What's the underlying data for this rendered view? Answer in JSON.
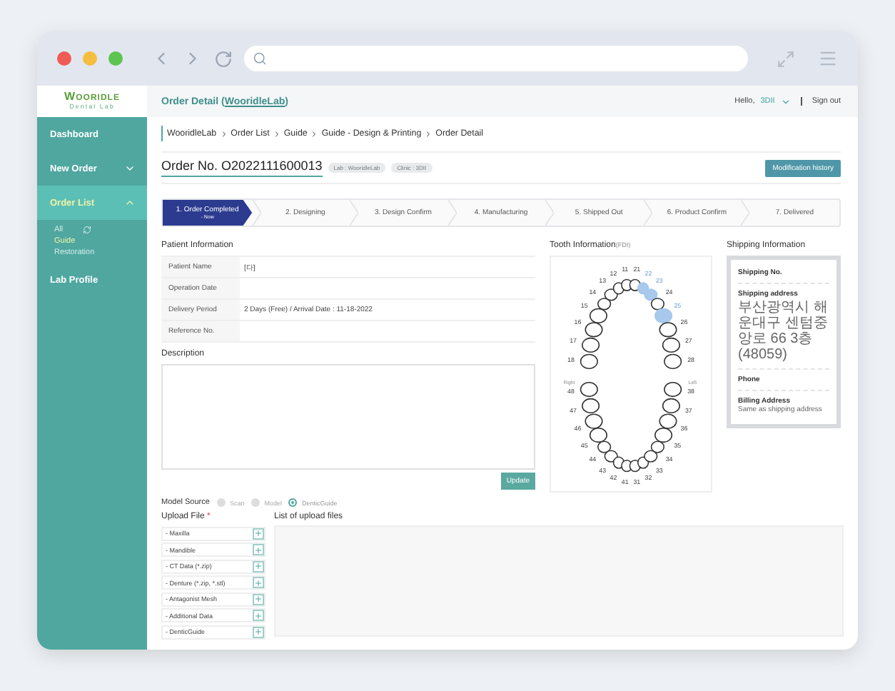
{
  "logo": {
    "name": "WOORIDLE",
    "subtitle": "Dental Lab"
  },
  "sidebar": {
    "items": [
      {
        "label": "Dashboard",
        "kind": "link",
        "expanded": false
      },
      {
        "label": "New Order",
        "kind": "group",
        "expanded": false
      },
      {
        "label": "Order List",
        "kind": "group",
        "expanded": true,
        "children": [
          {
            "label": "All",
            "selected": false,
            "refresh": true
          },
          {
            "label": "Guide",
            "selected": true,
            "refresh": false
          },
          {
            "label": "Restoration",
            "selected": false,
            "refresh": false
          }
        ]
      },
      {
        "label": "Lab Profile",
        "kind": "link",
        "expanded": false
      }
    ]
  },
  "header": {
    "title_before": "Order Detail (",
    "title_link": "WooridleLab",
    "title_after": ")",
    "greeting": "Hello,",
    "user": "3DII",
    "sign_out": "Sign out"
  },
  "breadcrumb": [
    "WooridleLab",
    "Order List",
    "Guide",
    "Guide - Design & Printing",
    "Order Detail"
  ],
  "order": {
    "number": "Order No. O2022111600013",
    "badges": [
      "Lab : WooridleLab",
      "Clinic : 3DII"
    ],
    "history_button": "Modification history"
  },
  "steps": [
    {
      "label": "1. Order Completed",
      "note": "- Now",
      "selected": true
    },
    {
      "label": "2. Designing",
      "selected": false
    },
    {
      "label": "3. Design Confirm",
      "selected": false
    },
    {
      "label": "4. Manufacturing",
      "selected": false
    },
    {
      "label": "5. Shipped Out",
      "selected": false
    },
    {
      "label": "6. Product Confirm",
      "selected": false
    },
    {
      "label": "7. Delivered",
      "selected": false
    }
  ],
  "patient": {
    "title": "Patient Information",
    "rows": [
      {
        "label": "Patient Name",
        "value": "[다]"
      },
      {
        "label": "Operation Date"
      },
      {
        "label": "Delivery Period",
        "value": "2 Days (Free) / Arrival Date : 11-18-2022"
      },
      {
        "label": "Reference No."
      }
    ]
  },
  "description": {
    "title": "Description",
    "button": "Update"
  },
  "model_source": {
    "label": "Model Source",
    "options": [
      {
        "label": "Scan",
        "selected": false
      },
      {
        "label": "Model",
        "selected": false
      },
      {
        "label": "DenticGuide",
        "selected": true
      }
    ]
  },
  "upload": {
    "title": "Upload File",
    "required_mark": "*",
    "items": [
      "- Maxilla",
      "- Mandible",
      "- CT Data (*.zip)",
      "- Denture (*.zip, *.stl)",
      "- Antagonist Mesh",
      "- Additional Data",
      "- DenticGuide"
    ],
    "list_title": "List of upload files"
  },
  "tooth": {
    "title": "Tooth Information",
    "system": "(FDI)",
    "right_label": "Right",
    "left_label": "Left",
    "upper": [
      {
        "label": "18",
        "selected": false
      },
      {
        "label": "17",
        "selected": false
      },
      {
        "label": "16",
        "selected": false
      },
      {
        "label": "15",
        "selected": false
      },
      {
        "label": "14",
        "selected": false
      },
      {
        "label": "13",
        "selected": false
      },
      {
        "label": "12",
        "selected": false
      },
      {
        "label": "11",
        "selected": false
      },
      {
        "label": "21",
        "selected": false
      },
      {
        "label": "22",
        "selected": true
      },
      {
        "label": "23",
        "selected": true
      },
      {
        "label": "24",
        "selected": false
      },
      {
        "label": "25",
        "selected": true
      },
      {
        "label": "26",
        "selected": false
      },
      {
        "label": "27",
        "selected": false
      },
      {
        "label": "28",
        "selected": false
      }
    ],
    "lower": [
      {
        "label": "48",
        "selected": false
      },
      {
        "label": "47",
        "selected": false
      },
      {
        "label": "46",
        "selected": false
      },
      {
        "label": "45",
        "selected": false
      },
      {
        "label": "44",
        "selected": false
      },
      {
        "label": "43",
        "selected": false
      },
      {
        "label": "42",
        "selected": false
      },
      {
        "label": "41",
        "selected": false
      },
      {
        "label": "31",
        "selected": false
      },
      {
        "label": "32",
        "selected": false
      },
      {
        "label": "33",
        "selected": false
      },
      {
        "label": "34",
        "selected": false
      },
      {
        "label": "35",
        "selected": false
      },
      {
        "label": "36",
        "selected": false
      },
      {
        "label": "37",
        "selected": false
      },
      {
        "label": "38",
        "selected": false
      }
    ]
  },
  "shipping": {
    "title": "Shipping Information",
    "fields": [
      {
        "label": "Shipping No."
      },
      {
        "label": "Shipping address",
        "value": "부산광역시 해운대구 센텀중앙로 66 3층 (48059)"
      },
      {
        "label": "Phone"
      },
      {
        "label": "Billing Address",
        "value": "Same as shipping address"
      }
    ]
  }
}
